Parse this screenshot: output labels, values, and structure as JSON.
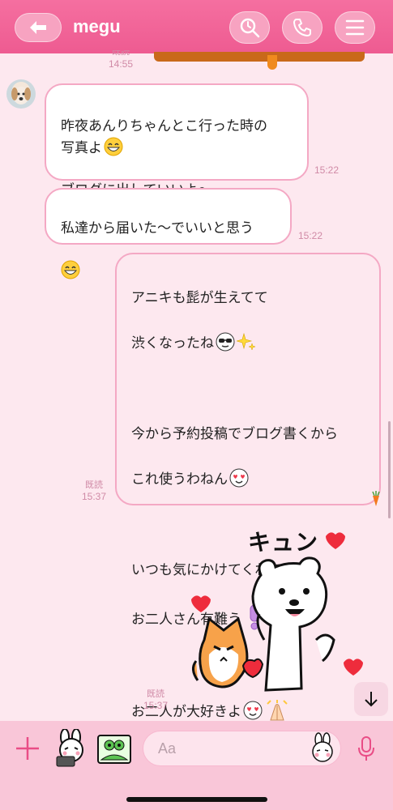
{
  "header": {
    "title": "megu",
    "background": "#ee5b91"
  },
  "messages": [
    {
      "read_label": "既読",
      "time": "14:55"
    },
    {
      "from": "them",
      "text": "昨夜あんりちゃんとこ行った時の\n写真よ",
      "text2": "\nブログに出していいよ〜",
      "time": "15:22"
    },
    {
      "from": "them",
      "text": "私達から届いた〜でいいと思う",
      "time": "15:22"
    },
    {
      "from": "me",
      "line1": "アニキも髭が生えてて",
      "line2": "渋くなったね",
      "line3": "今から予約投稿でブログ書くから",
      "line4": "これ使うわねん",
      "line5": "いつも気にかけてくれて",
      "line6": "お二人さん有難う",
      "line7": "お二人が大好きよ",
      "read_label": "既読",
      "time": "15:37"
    },
    {
      "from": "me",
      "type": "sticker",
      "sticker_text": "キュン",
      "read_label": "既読",
      "time": "15:37"
    }
  ],
  "composer": {
    "placeholder": "Aa"
  },
  "icons": [
    "back-arrow-icon",
    "search-icon",
    "phone-icon",
    "menu-icon",
    "plus-icon",
    "microphone-icon",
    "chevron-down-icon"
  ]
}
